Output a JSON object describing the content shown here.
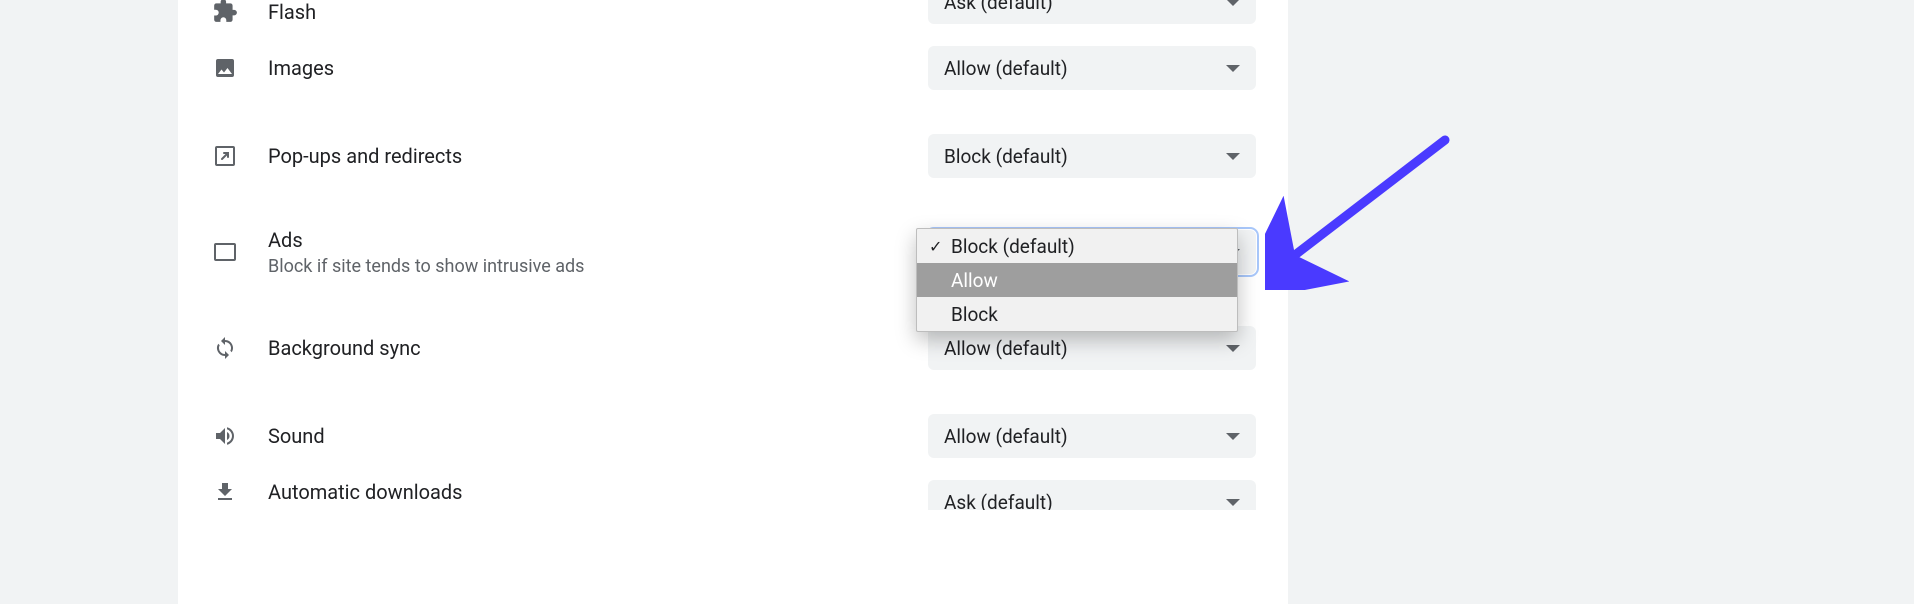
{
  "permissions": [
    {
      "key": "flash",
      "title": "Flash",
      "subtitle": "",
      "selected": "Ask (default)"
    },
    {
      "key": "images",
      "title": "Images",
      "subtitle": "",
      "selected": "Allow (default)"
    },
    {
      "key": "popups",
      "title": "Pop-ups and redirects",
      "subtitle": "",
      "selected": "Block (default)"
    },
    {
      "key": "ads",
      "title": "Ads",
      "subtitle": "Block if site tends to show intrusive ads",
      "selected": "Block (default)"
    },
    {
      "key": "bgsync",
      "title": "Background sync",
      "subtitle": "",
      "selected": "Allow (default)"
    },
    {
      "key": "sound",
      "title": "Sound",
      "subtitle": "",
      "selected": "Allow (default)"
    },
    {
      "key": "downloads",
      "title": "Automatic downloads",
      "subtitle": "",
      "selected": "Ask (default)"
    }
  ],
  "dropdown": {
    "options": [
      {
        "label": "Block (default)",
        "checked": true,
        "highlighted": false
      },
      {
        "label": "Allow",
        "checked": false,
        "highlighted": true
      },
      {
        "label": "Block",
        "checked": false,
        "highlighted": false
      }
    ]
  },
  "annotation": {
    "arrow_color": "#4a3aff"
  }
}
